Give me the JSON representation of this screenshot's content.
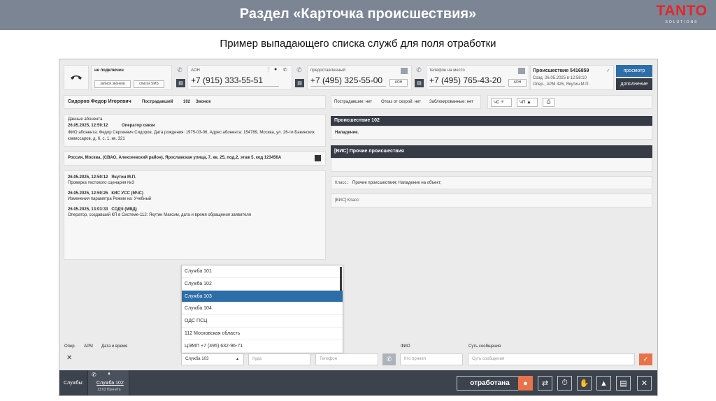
{
  "slide": {
    "title": "Раздел «Карточка происшествия»",
    "subtitle": "Пример выпадающего списка служб для поля отработки",
    "brand": "TANTO",
    "brand_sub": "SOLUTIONS"
  },
  "top_bar": {
    "line1": {
      "status": "не подключен",
      "btn_calls": "записи звонков",
      "btn_sms": "список SMS"
    },
    "aon": {
      "label": "АОН",
      "number": "+7 (915) 333-55-51"
    },
    "provided": {
      "label": "предоставленный",
      "number": "+7 (495) 325-55-00",
      "tag": "АОН"
    },
    "onsite": {
      "label": "телефон на место",
      "number": "+7 (495) 765-43-20",
      "tag": "АОН"
    },
    "incident": {
      "title": "Происшествие 5416859",
      "created": "Созд. 26.05.2025 в 12:58:10",
      "operator": "Опер., АРМ 426, Якутин М.П.",
      "btn_view": "просмотр",
      "btn_more": "дополнение"
    }
  },
  "caller": {
    "name": "Сидоров Федор Игоревич",
    "role": "Пострадавший",
    "code": "102",
    "kind": "Звонок"
  },
  "subscriber": {
    "header": "Данные абонента",
    "date": "26.05.2025, 12:59:12",
    "source": "Оператор связи",
    "text": "ФИО абонента: Федор Сергеевич Сидоров, Дата рождения: 1975-03-06, Адрес абонента: 154789, Москва, ул. 26-ти Бакинских комиссаров, д. 6, с. 1, кв. 321"
  },
  "address": "Россия, Москва, (СВАО, Алексеевский район), Ярославская улица, 7, кв. 25, под.2, этаж 5, код 123456А",
  "log": [
    {
      "date": "26.05.2025, 12:59:12",
      "author": "Якутин М.П.",
      "text": "Проверка тестового сценария №3"
    },
    {
      "date": "26.05.2025, 12:59:25",
      "author": "КИС УСС (МЧС)",
      "text": "Изменения параметра Режим на: Учебный"
    },
    {
      "date": "26.05.2025, 13:03:33",
      "author": "СОДЧ (МВД)",
      "text": "Оператор, создавший КП в Системе-112: Якутин Максим, дата и время обращения заявителя"
    }
  ],
  "status_line": {
    "victims": "Пострадавшие: нет",
    "ambulance": "Отказ от скорой: нет",
    "blocked": "Заблокированные: нет",
    "btn_chs": "ЧС",
    "btn_chp": "ЧП"
  },
  "right": {
    "incident_bar": "Происшествие 102",
    "incident_text": "Нападение.",
    "vis_bar": "[ВИС] Прочие происшествия",
    "class_label": "Класс.:",
    "class_value": "Прочие происшествия; Нападение на объект;",
    "vis_class": "[ВИС] Класс:"
  },
  "dropdown": {
    "items": [
      "Служба 101",
      "Служба 102",
      "Служба 103",
      "Служба 104",
      "ОДС ПСЦ",
      "112 Московская область",
      "ЦЭМП +7 (495) 632-96-71"
    ],
    "selected_index": 2
  },
  "form": {
    "col_oper": "Опер.",
    "col_arm": "АРМ",
    "col_datetime": "Дата и время",
    "col_fio": "ФИО",
    "col_message": "Суть сообщения",
    "select_value": "Служба 103",
    "where_placeholder": "Куда",
    "phone_placeholder": "Телефон",
    "who_placeholder": "Кто принял",
    "message_placeholder": "Суть сообщения"
  },
  "bottom_bar": {
    "services_label": "Службы:",
    "tab_label": "Служба 102",
    "tab_sub": "13:03 Принята",
    "btn_done": "отработана"
  },
  "colors": {
    "header": "#7c8594",
    "dark": "#363b45",
    "accent_blue": "#2d6ea8",
    "brand_red": "#e3262d",
    "confirm_orange": "#e8734a"
  }
}
